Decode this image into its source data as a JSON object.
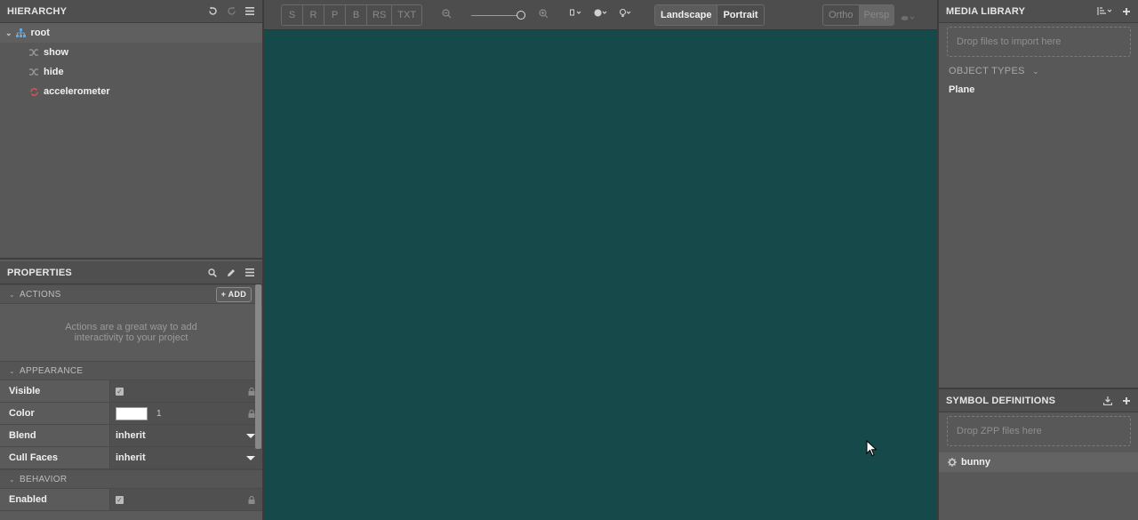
{
  "hierarchy": {
    "title": "HIERARCHY",
    "root_label": "root",
    "children": [
      {
        "label": "show",
        "icon": "shuffle-icon"
      },
      {
        "label": "hide",
        "icon": "shuffle-icon"
      },
      {
        "label": "accelerometer",
        "icon": "sync-icon",
        "icon_color": "#d9534f"
      }
    ]
  },
  "properties": {
    "title": "PROPERTIES",
    "actions_header": "ACTIONS",
    "add_label": "+ ADD",
    "actions_empty": "Actions are a great way to add interactivity to your project",
    "appearance_header": "APPEARANCE",
    "visible_label": "Visible",
    "color_label": "Color",
    "color_alpha": "1",
    "color_value": "#ffffff",
    "blend_label": "Blend",
    "blend_value": "inherit",
    "cull_label": "Cull Faces",
    "cull_value": "inherit",
    "behavior_header": "BEHAVIOR",
    "enabled_label": "Enabled"
  },
  "toolbar": {
    "tools": [
      "S",
      "R",
      "P",
      "B",
      "RS",
      "TXT"
    ],
    "orientation": [
      "Landscape",
      "Portrait"
    ],
    "projection": [
      "Ortho",
      "Persp"
    ]
  },
  "viewport": {
    "background": "#16494a"
  },
  "media": {
    "title": "MEDIA LIBRARY",
    "drop_text": "Drop files to import here",
    "object_types_label": "OBJECT TYPES",
    "object_types": [
      "Plane"
    ]
  },
  "symbols": {
    "title": "SYMBOL DEFINITIONS",
    "drop_text": "Drop ZPP files here",
    "items": [
      "bunny"
    ]
  }
}
